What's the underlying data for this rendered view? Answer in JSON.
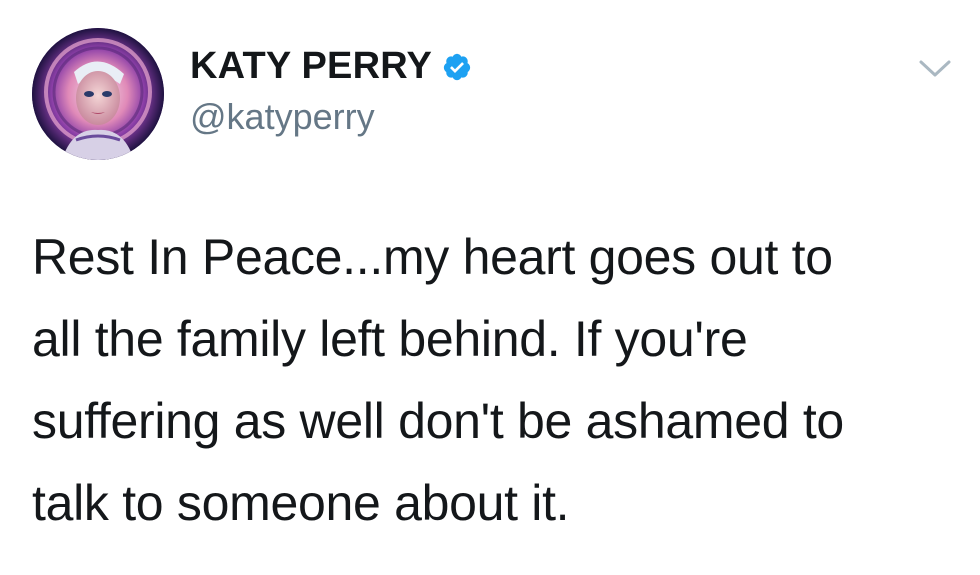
{
  "tweet": {
    "author": {
      "display_name": "KATY PERRY",
      "handle": "@katyperry",
      "verified": true,
      "verified_icon": "verified-badge-icon",
      "avatar_icon": "profile-photo"
    },
    "menu_icon": "chevron-down-icon",
    "text_lines": [
      "Rest In Peace...my heart goes out to",
      "all the family left behind. If you're",
      "suffering as well don't be ashamed to",
      "talk to someone about it."
    ]
  },
  "colors": {
    "text": "#14171a",
    "secondary_text": "#657786",
    "verified_blue": "#1da1f2",
    "chevron": "#aab8c2",
    "background": "#ffffff"
  }
}
